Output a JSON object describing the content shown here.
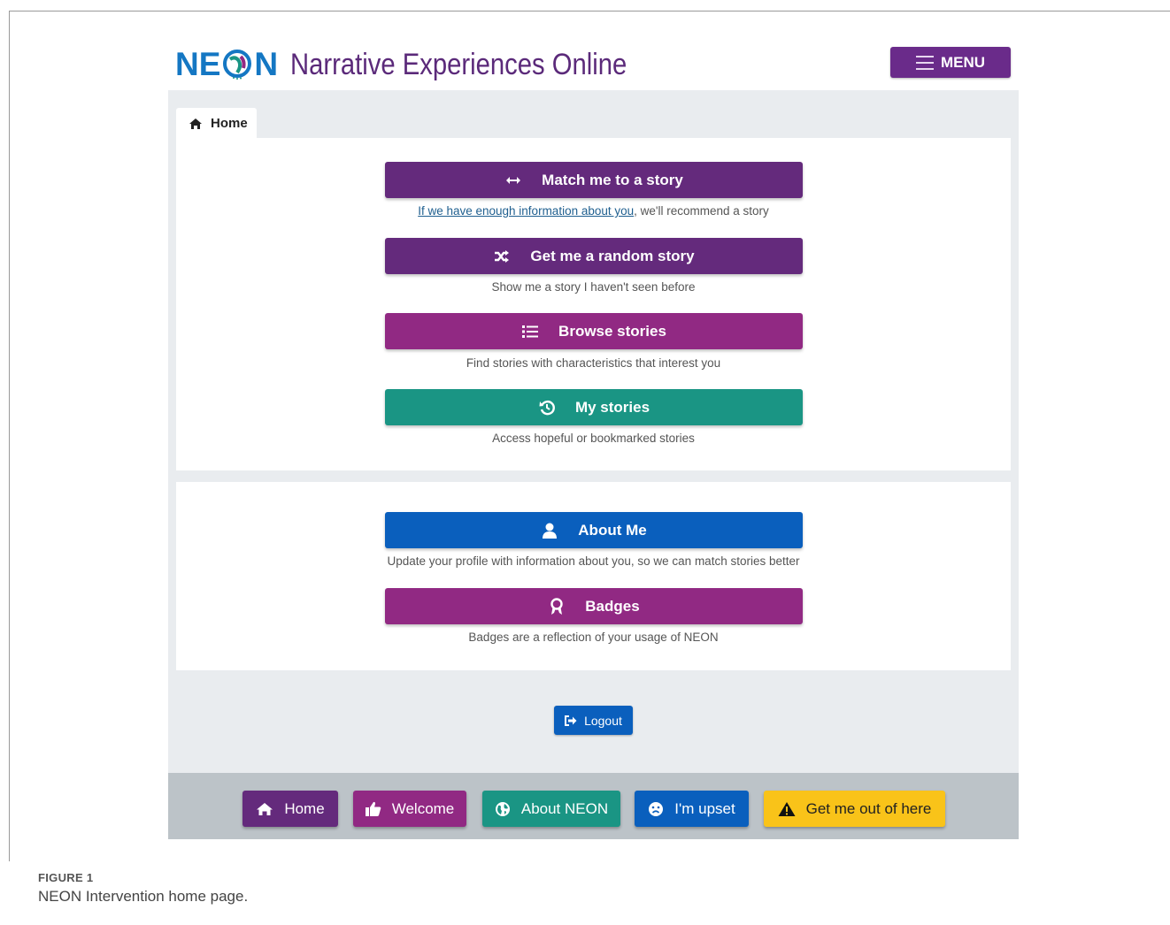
{
  "app": {
    "logo_text_left": "NE",
    "logo_text_right": "N",
    "title": "Narrative Experiences Online",
    "menu_label": "MENU"
  },
  "tab": {
    "label": "Home"
  },
  "actions": [
    {
      "label": "Match me to a story",
      "icon": "arrows-horizontal-icon",
      "color": "#642a7c",
      "caption_link": "If we have enough information about you",
      "caption_rest": ", we'll recommend a story"
    },
    {
      "label": "Get me a random story",
      "icon": "shuffle-icon",
      "color": "#642a7c",
      "caption": "Show me a story I haven't seen before"
    },
    {
      "label": "Browse stories",
      "icon": "list-icon",
      "color": "#912983",
      "caption": "Find stories with characteristics that interest you"
    },
    {
      "label": "My stories",
      "icon": "history-icon",
      "color": "#1a9584",
      "caption": "Access hopeful or bookmarked stories"
    }
  ],
  "profile_actions": [
    {
      "label": "About Me",
      "icon": "user-icon",
      "color": "#0a5fbd",
      "caption": "Update your profile with information about you, so we can match stories better"
    },
    {
      "label": "Badges",
      "icon": "award-icon",
      "color": "#912983",
      "caption": "Badges are a reflection of your usage of NEON"
    }
  ],
  "logout": {
    "label": "Logout",
    "icon": "sign-out-icon"
  },
  "footer": [
    {
      "label": "Home",
      "icon": "home-icon",
      "color": "#642a7c"
    },
    {
      "label": "Welcome",
      "icon": "thumbs-up-icon",
      "color": "#912983"
    },
    {
      "label": "About NEON",
      "icon": "globe-icon",
      "color": "#1a9584"
    },
    {
      "label": "I'm upset",
      "icon": "frown-icon",
      "color": "#0a5fbd"
    },
    {
      "label": "Get me out of here",
      "icon": "warning-icon",
      "color": "#f9c319"
    }
  ],
  "figure": {
    "label": "FIGURE 1",
    "caption": "NEON Intervention home page."
  }
}
